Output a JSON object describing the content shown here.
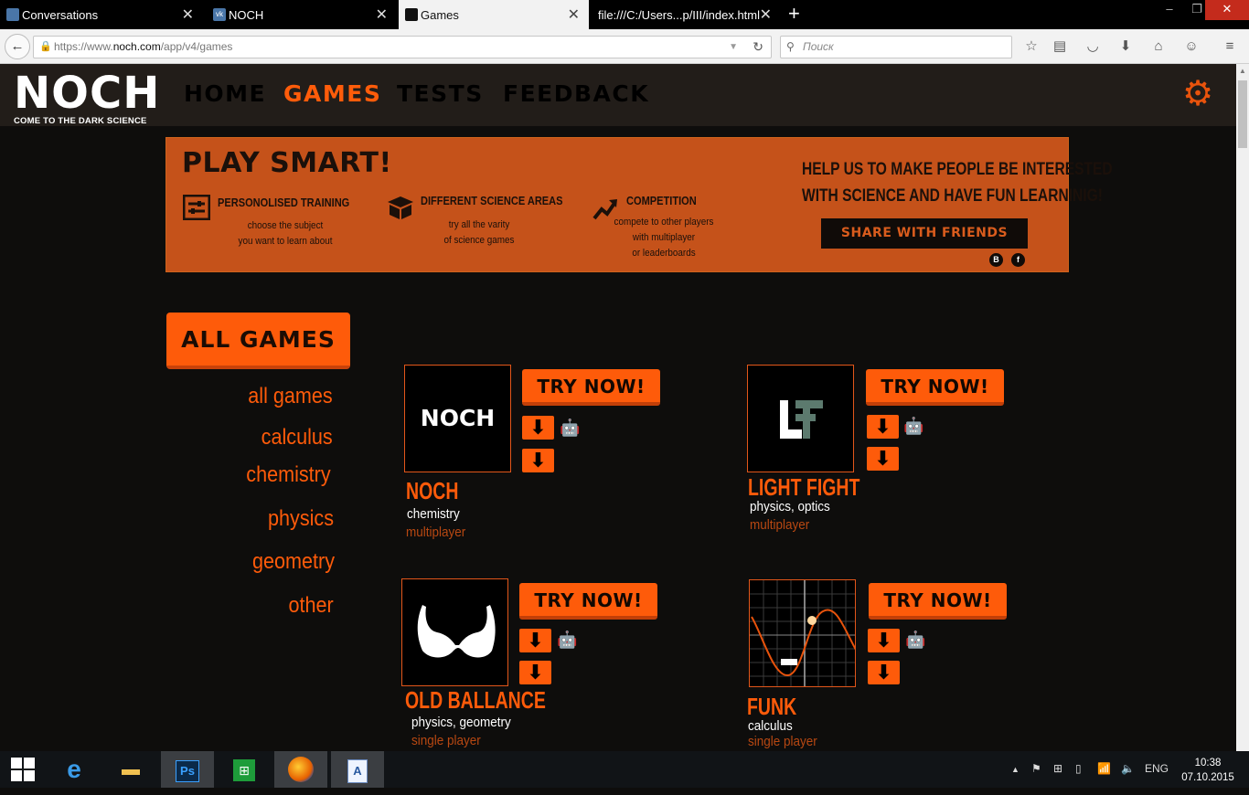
{
  "browser": {
    "tabs": [
      {
        "label": "Conversations",
        "favicon_color": "#4a76a8"
      },
      {
        "label": "NOCH",
        "favicon_color": "#4a76a8"
      },
      {
        "label": "Games",
        "favicon_color": "#111111"
      },
      {
        "label": "file:///C:/Users...p/III/index.html",
        "favicon_color": ""
      }
    ],
    "url_prefix": "https://www.",
    "url_host": "noch.com",
    "url_path": "/app/v4/games",
    "search_placeholder": "Поиск"
  },
  "site": {
    "logo": {
      "word": "NOCH",
      "tagline": "COME TO THE DARK SCIENCE"
    },
    "nav": [
      {
        "label": "HOME",
        "active": false
      },
      {
        "label": "GAMES",
        "active": true
      },
      {
        "label": "TESTS",
        "active": false
      },
      {
        "label": "FEEDBACK",
        "active": false
      }
    ],
    "accent_color": "#fe5b0a",
    "banner": {
      "title": "PLAY SMART!",
      "features": [
        {
          "title": "PERSONOLISED TRAINING",
          "desc_line1": "choose the subject",
          "desc_line2": "you want to learn about",
          "desc_line3": "",
          "icon": "sliders-icon"
        },
        {
          "title": "DIFFERENT SCIENCE AREAS",
          "desc_line1": "try all the varity",
          "desc_line2": "of science games",
          "desc_line3": "",
          "icon": "box-icon"
        },
        {
          "title": "COMPETITION",
          "desc_line1": "compete to other players",
          "desc_line2": "with multiplayer",
          "desc_line3": "or leaderboards",
          "icon": "trend-icon"
        }
      ],
      "help_line1": "HELP US TO MAKE PEOPLE BE INTERESTED",
      "help_line2": "WITH SCIENCE AND HAVE FUN LEARNINIG!",
      "share_label": "SHARE WITH FRIENDS",
      "social": [
        "B",
        "f"
      ]
    },
    "all_games_label": "ALL GAMES",
    "categories": [
      "all games",
      "calculus",
      "chemistry",
      "physics",
      "geometry",
      "other"
    ],
    "try_label": "TRY NOW!",
    "games": [
      {
        "name": "NOCH",
        "subjects": "chemistry",
        "mode": "multiplayer",
        "thumb_text": "NOCH"
      },
      {
        "name": "LIGHT FIGHT",
        "subjects": "physics, optics",
        "mode": "multiplayer",
        "thumb_text": ""
      },
      {
        "name": "OLD BALLANCE",
        "subjects": "physics, geometry",
        "mode": "single player",
        "thumb_text": ""
      },
      {
        "name": "FUNK",
        "subjects": "calculus",
        "mode": "single player",
        "thumb_text": ""
      }
    ]
  },
  "taskbar": {
    "lang": "ENG",
    "time": "10:38",
    "date": "07.10.2015"
  }
}
